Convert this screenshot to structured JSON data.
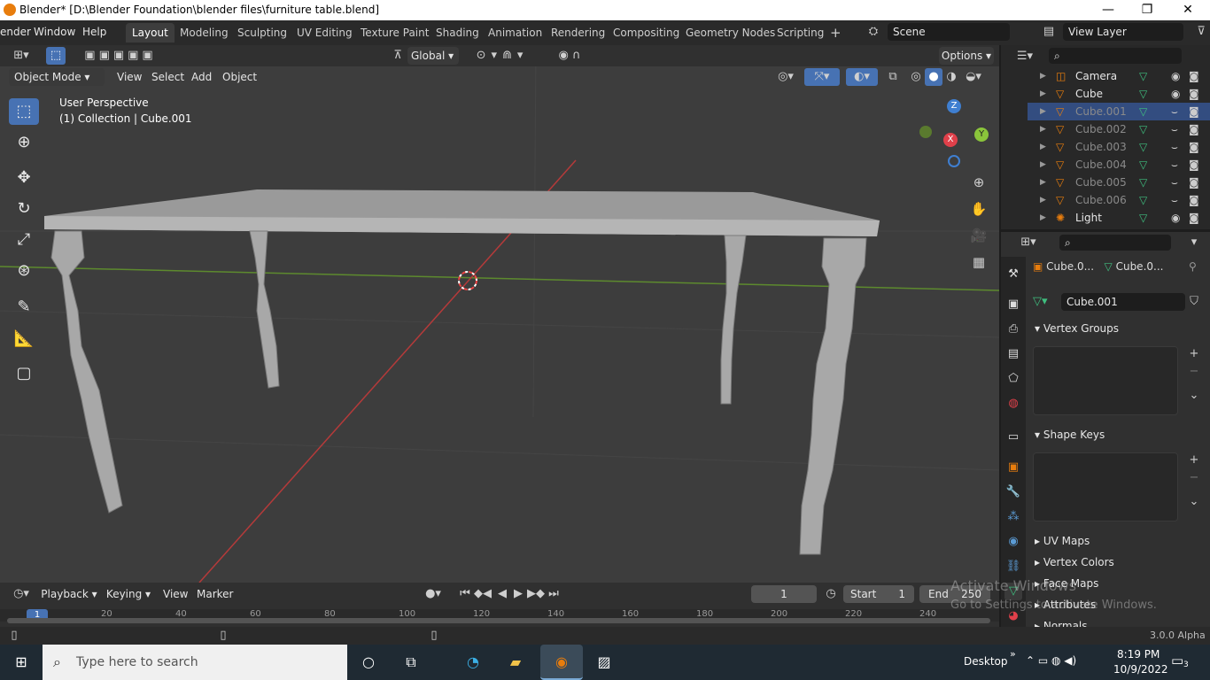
{
  "window": {
    "title": "Blender* [D:\\Blender Foundation\\blender files\\furniture table.blend]",
    "minimize": "—",
    "maximize": "❐",
    "close": "✕"
  },
  "menu": {
    "items": [
      "ender",
      "Window",
      "Help"
    ]
  },
  "workspaces": {
    "active": "Layout",
    "tabs": [
      "Layout",
      "Modeling",
      "Sculpting",
      "UV Editing",
      "Texture Paint",
      "Shading",
      "Animation",
      "Rendering",
      "Compositing",
      "Geometry Nodes",
      "Scripting"
    ],
    "add": "+"
  },
  "scene": {
    "label": "Scene",
    "view_layer": "View Layer"
  },
  "viewport_header": {
    "transform": "Global",
    "options": "Options",
    "mode": "Object Mode",
    "menus": [
      "View",
      "Select",
      "Add",
      "Object"
    ]
  },
  "viewport": {
    "perspective": "User Perspective",
    "collection": "(1) Collection | Cube.001"
  },
  "gizmo": {
    "z": "Z",
    "x": "X",
    "y": "Y"
  },
  "outliner": {
    "items": [
      {
        "name": "Camera",
        "icon": "camera-icon",
        "selected": false,
        "dim": false
      },
      {
        "name": "Cube",
        "icon": "mesh-icon",
        "selected": false,
        "dim": false
      },
      {
        "name": "Cube.001",
        "icon": "mesh-icon",
        "selected": true,
        "dim": true
      },
      {
        "name": "Cube.002",
        "icon": "mesh-icon",
        "selected": false,
        "dim": true
      },
      {
        "name": "Cube.003",
        "icon": "mesh-icon",
        "selected": false,
        "dim": true
      },
      {
        "name": "Cube.004",
        "icon": "mesh-icon",
        "selected": false,
        "dim": true
      },
      {
        "name": "Cube.005",
        "icon": "mesh-icon",
        "selected": false,
        "dim": true
      },
      {
        "name": "Cube.006",
        "icon": "mesh-icon",
        "selected": false,
        "dim": true
      },
      {
        "name": "Light",
        "icon": "light-icon",
        "selected": false,
        "dim": false
      }
    ]
  },
  "properties": {
    "object_name": "Cube.0...",
    "data_name": "Cube.0...",
    "mesh_name": "Cube.001",
    "panels": {
      "vertex_groups": "Vertex Groups",
      "shape_keys": "Shape Keys",
      "uv_maps": "UV Maps",
      "vertex_colors": "Vertex Colors",
      "face_maps": "Face Maps",
      "attributes": "Attributes",
      "normals": "Normals"
    }
  },
  "timeline": {
    "menus": [
      "Playback",
      "Keying",
      "View",
      "Marker"
    ],
    "current_frame": "1",
    "start_label": "Start",
    "start": "1",
    "end_label": "End",
    "end": "250",
    "ticks": [
      "1",
      "20",
      "40",
      "60",
      "80",
      "100",
      "120",
      "140",
      "160",
      "180",
      "200",
      "220",
      "240"
    ]
  },
  "status": {
    "version": "3.0.0 Alpha"
  },
  "watermark": {
    "line1": "Activate Windows",
    "line2": "Go to Settings to activate Windows."
  },
  "taskbar": {
    "search_placeholder": "Type here to search",
    "desktop": "Desktop",
    "time": "8:19 PM",
    "date": "10/9/2022",
    "notifications": "3"
  },
  "colors": {
    "accent": "#4772b3",
    "selection": "#334d80",
    "x_axis": "#e0404a",
    "y_axis": "#8ac43b",
    "z_axis": "#3f7fd1"
  }
}
